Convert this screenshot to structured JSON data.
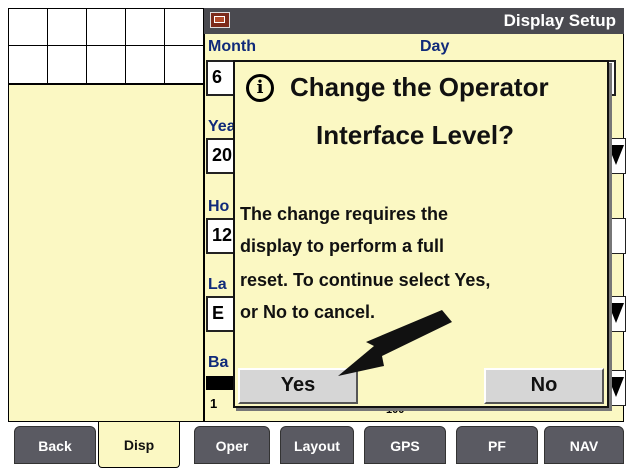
{
  "titlebar": {
    "title": "Display Setup",
    "icon": "display-setup-icon"
  },
  "form": {
    "month": {
      "label": "Month",
      "value": "6"
    },
    "day": {
      "label": "Day"
    },
    "year": {
      "label": "Yea",
      "value": "20"
    },
    "hour": {
      "label": "Ho",
      "value": "12"
    },
    "language": {
      "label": "La",
      "value": "E"
    },
    "backlight": {
      "label": "Ba",
      "min": "1",
      "max": "100"
    }
  },
  "dialog": {
    "icon": "info-icon",
    "icon_glyph": "i",
    "title_line1": "Change the Operator",
    "title_line2": "Interface Level?",
    "message": [
      "The change requires the",
      "display to perform a full",
      "reset. To continue select Yes,",
      "or No to cancel."
    ],
    "yes_label": "Yes",
    "no_label": "No"
  },
  "tabs": [
    {
      "label": "Back"
    },
    {
      "label": "Disp",
      "active": true
    },
    {
      "label": "Oper"
    },
    {
      "label": "Layout"
    },
    {
      "label": "GPS"
    },
    {
      "label": "PF"
    },
    {
      "label": "NAV"
    }
  ],
  "colors": {
    "panel_bg": "#fbf8c3",
    "titlebar_bg": "#4a4a50",
    "label_blue": "#102a7a",
    "tab_bg": "#5a5a62"
  }
}
